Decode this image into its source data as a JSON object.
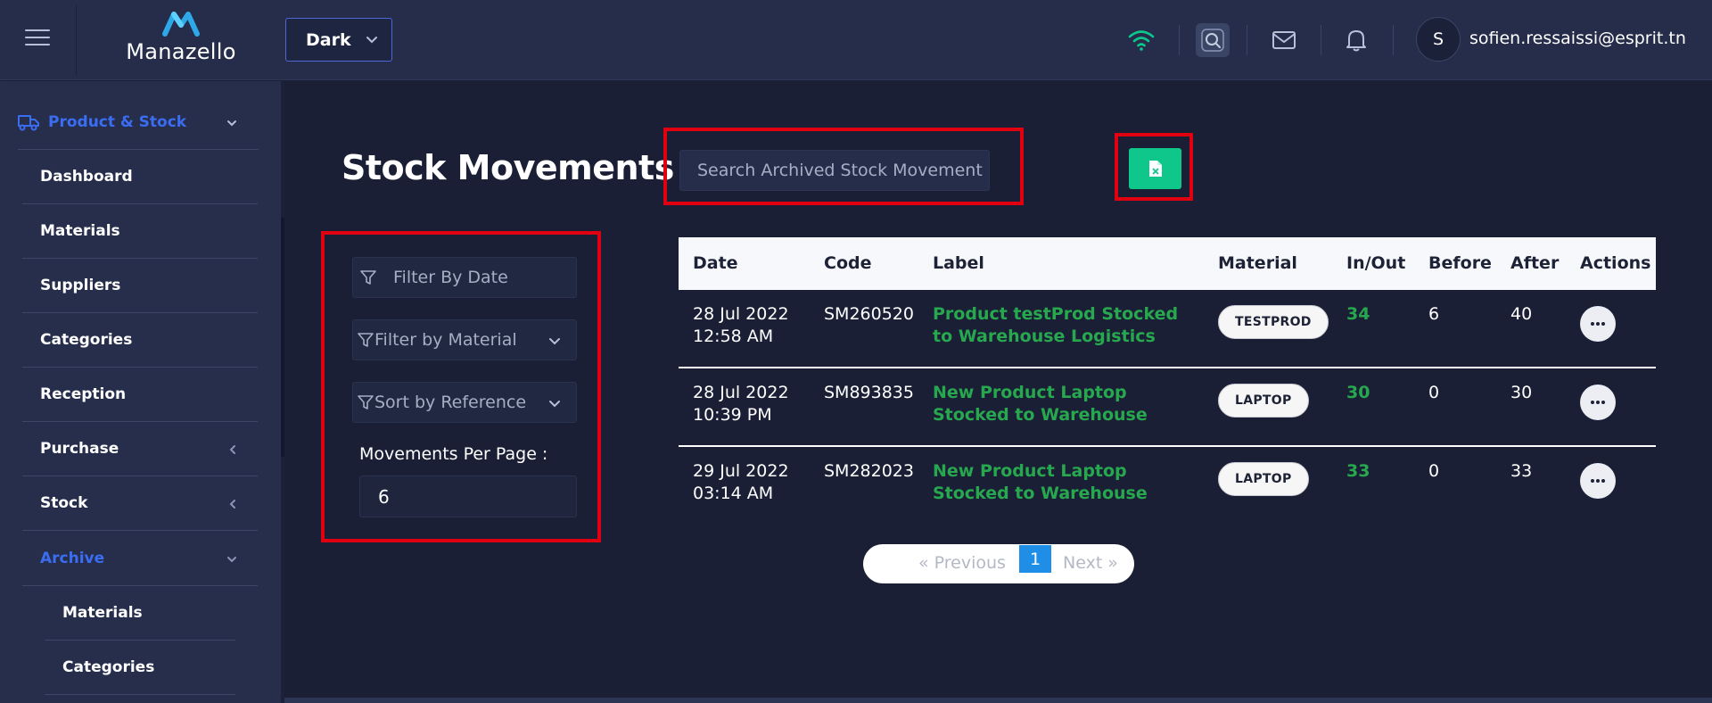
{
  "header": {
    "app_name": "Manazello",
    "theme_label": "Dark",
    "avatar_initial": "S",
    "user_email": "sofien.ressaissi@esprit.tn"
  },
  "sidebar": {
    "section": "Product & Stock",
    "items": [
      {
        "label": "Dashboard"
      },
      {
        "label": "Materials"
      },
      {
        "label": "Suppliers"
      },
      {
        "label": "Categories"
      },
      {
        "label": "Reception"
      },
      {
        "label": "Purchase"
      },
      {
        "label": "Stock"
      },
      {
        "label": "Archive"
      }
    ],
    "archive_items": [
      {
        "label": "Materials"
      },
      {
        "label": "Categories"
      }
    ]
  },
  "main": {
    "title": "Stock Movements",
    "search_placeholder": "Search Archived Stock Movement",
    "filters": {
      "date_placeholder": "Filter By Date",
      "material_label": "Filter by Material",
      "sort_label": "Sort by Reference",
      "per_page_label": "Movements Per Page :",
      "per_page_value": "6"
    },
    "table": {
      "headers": [
        "Date",
        "Code",
        "Label",
        "Material",
        "In/Out",
        "Before",
        "After",
        "Actions"
      ],
      "rows": [
        {
          "date": "28 Jul 2022",
          "time": "12:58 AM",
          "code": "SM260520",
          "label": "Product testProd Stocked to Warehouse Logistics",
          "material": "TESTPROD",
          "inout": "34",
          "before": "6",
          "after": "40"
        },
        {
          "date": "28 Jul 2022",
          "time": "10:39 PM",
          "code": "SM893835",
          "label": "New Product Laptop Stocked to Warehouse",
          "material": "LAPTOP",
          "inout": "30",
          "before": "0",
          "after": "30"
        },
        {
          "date": "29 Jul 2022",
          "time": "03:14 AM",
          "code": "SM282023",
          "label": "New Product Laptop Stocked to Warehouse",
          "material": "LAPTOP",
          "inout": "33",
          "before": "0",
          "after": "33"
        }
      ]
    },
    "pagination": {
      "previous": "«  Previous",
      "page": "1",
      "next": "Next  »"
    }
  },
  "colors": {
    "accent_blue": "#3b6df2",
    "excel_green": "#0fc78a",
    "label_green": "#27a84f",
    "annotation_red": "#e1000f"
  }
}
